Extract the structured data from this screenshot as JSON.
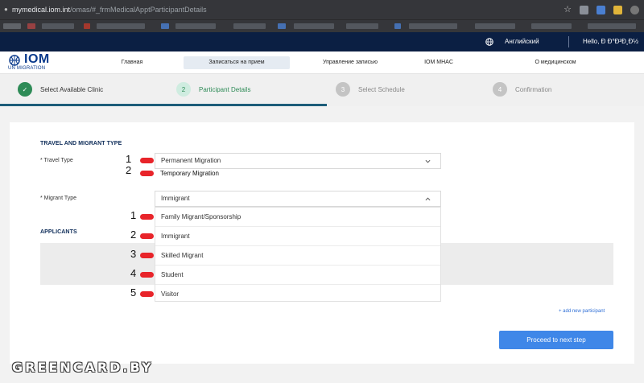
{
  "browser": {
    "url_domain": "mymedical.iom.int",
    "url_path": "/omas/#_frmMedicalApptParticipantDetails"
  },
  "topbar": {
    "language": "Английский",
    "greeting": "Hello, Ð   Ð°Ð²Ð¸Ð½"
  },
  "nav": {
    "logo_text": "IOM",
    "logo_sub": "UN MIGRATION",
    "items": [
      {
        "label": "Главная"
      },
      {
        "label": "Записаться на прием"
      },
      {
        "label": "Управление записью"
      },
      {
        "label": "IOM MHAC"
      },
      {
        "label": "О медицинском"
      }
    ]
  },
  "stepper": {
    "steps": [
      {
        "number": "✓",
        "label": "Select Available Clinic",
        "state": "done",
        "color": "#2e8b57"
      },
      {
        "number": "2",
        "label": "Participant Details",
        "state": "active",
        "color": "#8fd1b0"
      },
      {
        "number": "3",
        "label": "Select Schedule",
        "state": "pending",
        "color": "#c4c4c4"
      },
      {
        "number": "4",
        "label": "Confirmation",
        "state": "pending",
        "color": "#c4c4c4"
      }
    ]
  },
  "form": {
    "section_title": "TRAVEL AND MIGRANT TYPE",
    "travel_type_label": "* Travel Type",
    "travel_type_value": "Permanent Migration",
    "travel_type_options": [
      {
        "number": "1",
        "label": "Permanent Migration"
      },
      {
        "number": "2",
        "label": "Temporary Migration"
      }
    ],
    "migrant_type_label": "* Migrant Type",
    "migrant_type_value": "Immigrant",
    "migrant_type_options": [
      {
        "number": "1",
        "label": "Family Migrant/Sponsorship"
      },
      {
        "number": "2",
        "label": "Immigrant"
      },
      {
        "number": "3",
        "label": "Skilled Migrant"
      },
      {
        "number": "4",
        "label": "Student"
      },
      {
        "number": "5",
        "label": "Visitor"
      }
    ],
    "applicants_title": "APPLICANTS",
    "add_participant": "+ add new participant",
    "proceed_button": "Proceed to next step"
  },
  "watermark": "GREENCARD.BY",
  "colors": {
    "topbar_bg": "#0b1f43",
    "accent_blue": "#3f87e8",
    "marker_red": "#e8242a"
  }
}
